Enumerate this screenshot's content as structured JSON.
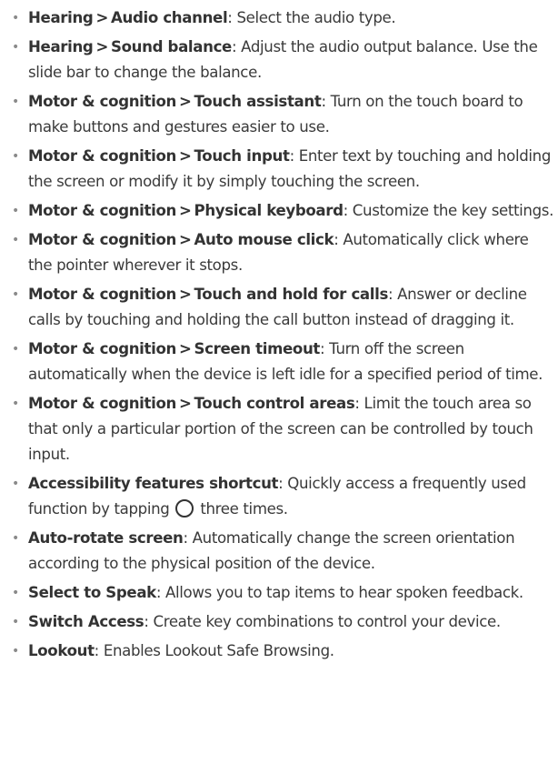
{
  "items": [
    {
      "a": "Hearing",
      "b": "Audio channel",
      "desc": ": Select the audio type."
    },
    {
      "a": "Hearing",
      "b": "Sound balance",
      "desc": ": Adjust the audio output balance. Use the slide bar to change the balance."
    },
    {
      "a": "Motor & cognition",
      "b": "Touch assistant",
      "desc": ": Turn on the touch board to make buttons and gestures easier to use."
    },
    {
      "a": "Motor & cognition",
      "b": "Touch input",
      "desc": ": Enter text by touching and holding the screen or modify it by simply touching the screen."
    },
    {
      "a": "Motor & cognition",
      "b": "Physical keyboard",
      "desc": ": Customize the key settings."
    },
    {
      "a": "Motor & cognition",
      "b": "Auto mouse click",
      "desc": ": Automatically click where the pointer wherever it stops."
    },
    {
      "a": "Motor & cognition",
      "b": "Touch and hold for calls",
      "desc": ": Answer or decline calls by touching and holding the call button instead of dragging it."
    },
    {
      "a": "Motor & cognition",
      "b": "Screen timeout",
      "desc": ": Turn off the screen automatically when the device is left idle for a specified period of time."
    },
    {
      "a": "Motor & cognition",
      "b": "Touch control areas",
      "desc": ": Limit the touch area so that only a particular portion of the screen can be controlled by touch input."
    },
    {
      "a": "Accessibility features shortcut",
      "desc_before": ": Quickly access a frequently used function by tapping",
      "desc_after": "three times.",
      "icon": "home-button-icon"
    },
    {
      "a": "Auto-rotate screen",
      "desc": ": Automatically change the screen orientation according to the physical position of the device."
    },
    {
      "a": "Select to Speak",
      "desc": ": Allows you to tap items to hear spoken feedback."
    },
    {
      "a": "Switch Access",
      "desc": ": Create key combinations to control your device."
    },
    {
      "a": "Lookout",
      "desc": ": Enables Lookout Safe Browsing."
    }
  ],
  "separator": ">",
  "bullet": "•"
}
